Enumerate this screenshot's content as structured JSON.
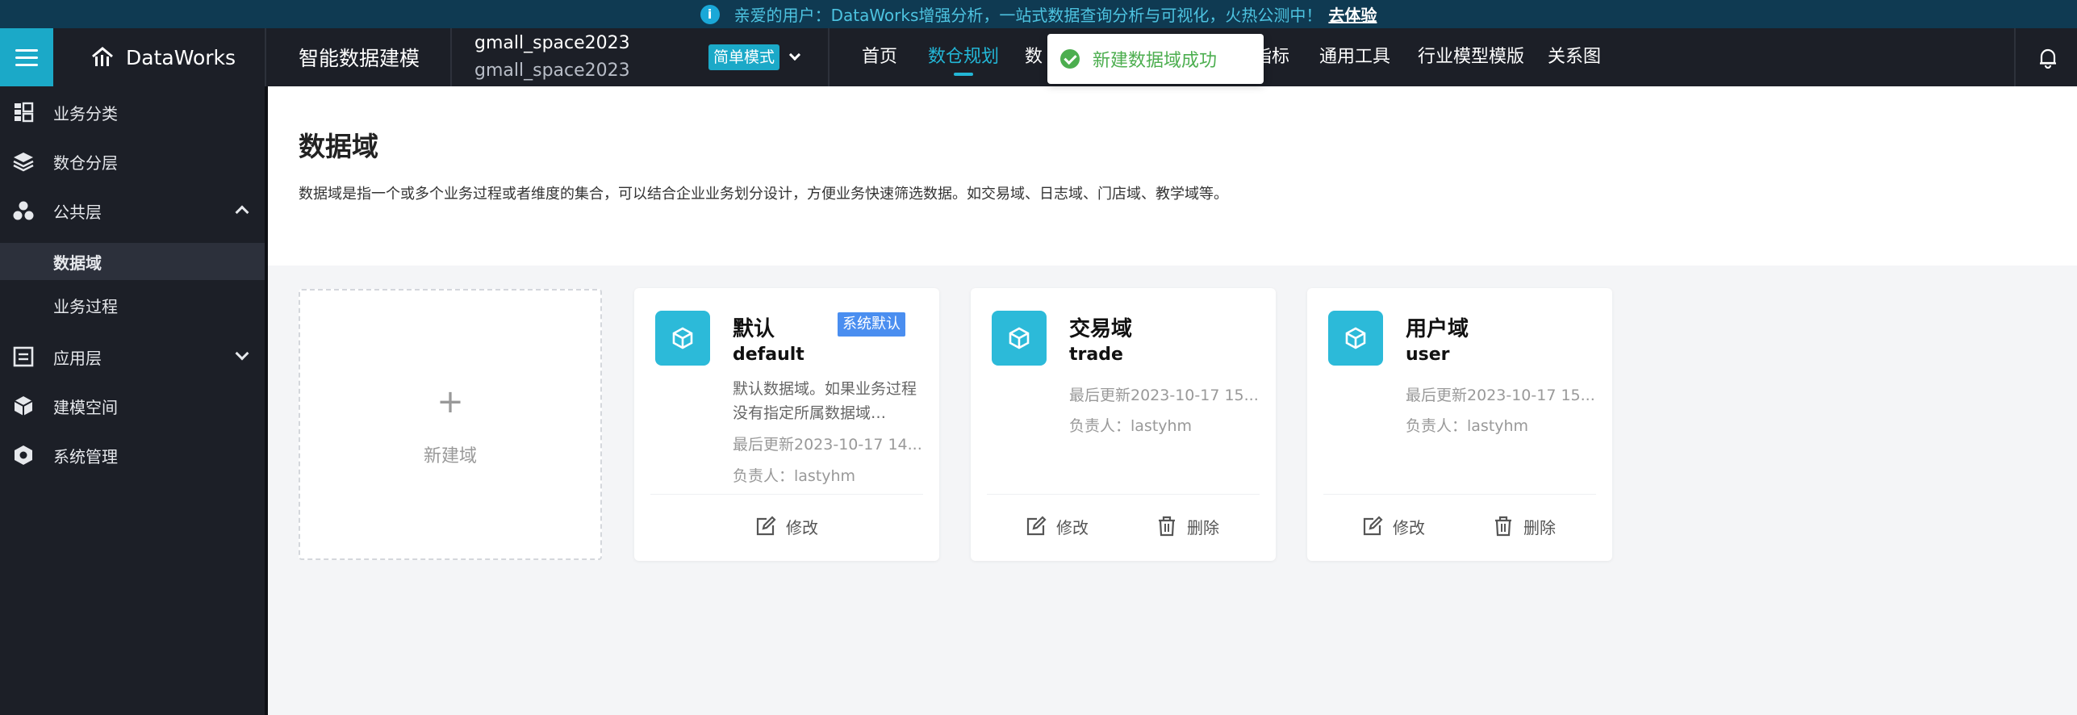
{
  "announcement": {
    "text": "亲爱的用户：DataWorks增强分析，一站式数据查询分析与可视化，火热公测中！",
    "link": "去体验"
  },
  "topbar": {
    "brand": "DataWorks",
    "product": "智能数据建模",
    "workspace": "gmall_space2023",
    "workspace_sub": "gmall_space2023",
    "mode": "简单模式",
    "nav": [
      "首页",
      "数仓规划",
      "数",
      "指标",
      "通用工具",
      "行业模型模版",
      "关系图"
    ],
    "active_nav": "数仓规划"
  },
  "toast": {
    "text": "新建数据域成功"
  },
  "sidebar": {
    "items": [
      {
        "label": "业务分类",
        "icon": "category-icon"
      },
      {
        "label": "数仓分层",
        "icon": "layers-icon"
      },
      {
        "label": "公共层",
        "icon": "cluster-icon",
        "expanded": true
      },
      {
        "label": "数据域",
        "active": true
      },
      {
        "label": "业务过程"
      },
      {
        "label": "应用层",
        "icon": "list-icon",
        "expanded": false
      },
      {
        "label": "建模空间",
        "icon": "cube-icon"
      },
      {
        "label": "系统管理",
        "icon": "settings-icon"
      }
    ]
  },
  "page": {
    "title": "数据域",
    "description": "数据域是指一个或多个业务过程或者维度的集合，可以结合企业业务划分设计，方便业务快速筛选数据。如交易域、日志域、门店域、教学域等。"
  },
  "new_card": {
    "plus": "+",
    "label": "新建域"
  },
  "cards": [
    {
      "name": "默认",
      "code": "default",
      "tag": "系统默认",
      "description": "默认数据域。如果业务过程没有指定所属数据域…",
      "updated": "最后更新2023-10-17 14...",
      "owner": "负责人：lastyhm",
      "edit": "修改"
    },
    {
      "name": "交易域",
      "code": "trade",
      "updated": "最后更新2023-10-17 15...",
      "owner": "负责人：lastyhm",
      "edit": "修改",
      "delete": "删除"
    },
    {
      "name": "用户域",
      "code": "user",
      "updated": "最后更新2023-10-17 15...",
      "owner": "负责人：lastyhm",
      "edit": "修改",
      "delete": "删除"
    }
  ],
  "colors": {
    "accent": "#1ba9c8",
    "sidebar_bg": "#1c1f27",
    "success": "#4cae4f",
    "tag": "#4a8ef0"
  }
}
